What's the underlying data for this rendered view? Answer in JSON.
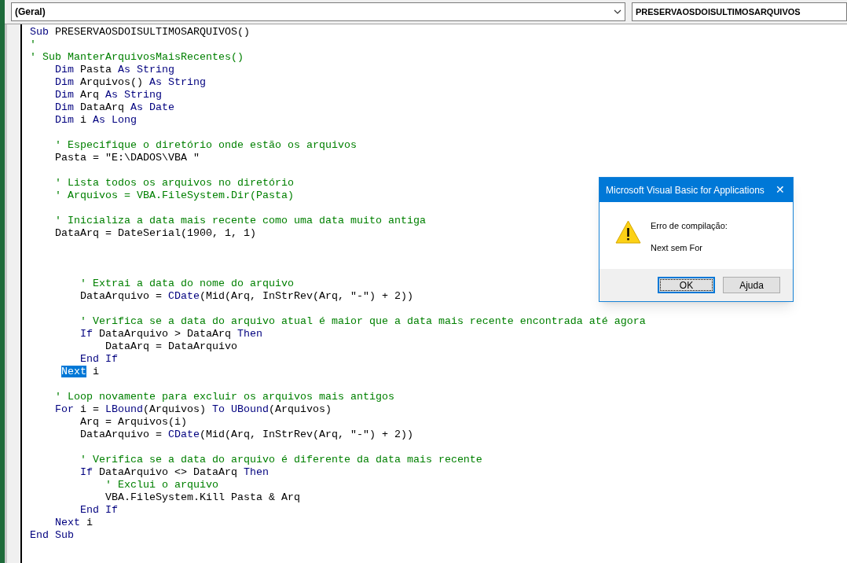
{
  "object_combo": {
    "value": "(Geral)"
  },
  "procedure_combo": {
    "value": "PRESERVAOSDOISULTIMOSARQUIVOS"
  },
  "code_lines": [
    {
      "kind": "code",
      "segments": [
        {
          "text": "Sub",
          "kind": "keyword"
        },
        {
          "text": " PRESERVAOSDOISULTIMOSARQUIVOS()",
          "kind": "plain"
        }
      ]
    },
    {
      "kind": "code",
      "segments": [
        {
          "text": "'",
          "kind": "comment"
        }
      ]
    },
    {
      "kind": "code",
      "segments": [
        {
          "text": "' Sub ManterArquivosMaisRecentes()",
          "kind": "comment"
        }
      ]
    },
    {
      "kind": "code",
      "segments": [
        {
          "text": "    Dim",
          "kind": "keyword"
        },
        {
          "text": " Pasta ",
          "kind": "plain"
        },
        {
          "text": "As String",
          "kind": "keyword"
        }
      ]
    },
    {
      "kind": "code",
      "segments": [
        {
          "text": "    Dim",
          "kind": "keyword"
        },
        {
          "text": " Arquivos() ",
          "kind": "plain"
        },
        {
          "text": "As String",
          "kind": "keyword"
        }
      ]
    },
    {
      "kind": "code",
      "segments": [
        {
          "text": "    Dim",
          "kind": "keyword"
        },
        {
          "text": " Arq ",
          "kind": "plain"
        },
        {
          "text": "As String",
          "kind": "keyword"
        }
      ]
    },
    {
      "kind": "code",
      "segments": [
        {
          "text": "    Dim",
          "kind": "keyword"
        },
        {
          "text": " DataArq ",
          "kind": "plain"
        },
        {
          "text": "As Date",
          "kind": "keyword"
        }
      ]
    },
    {
      "kind": "code",
      "segments": [
        {
          "text": "    Dim",
          "kind": "keyword"
        },
        {
          "text": " i ",
          "kind": "plain"
        },
        {
          "text": "As Long",
          "kind": "keyword"
        }
      ]
    },
    {
      "kind": "blank"
    },
    {
      "kind": "code",
      "segments": [
        {
          "text": "    ' Especifique o diretório onde estão os arquivos",
          "kind": "comment"
        }
      ]
    },
    {
      "kind": "code",
      "segments": [
        {
          "text": "    Pasta = \"E:\\DADOS\\VBA \"",
          "kind": "plain"
        }
      ]
    },
    {
      "kind": "blank"
    },
    {
      "kind": "code",
      "segments": [
        {
          "text": "    ' Lista todos os arquivos no diretório",
          "kind": "comment"
        }
      ]
    },
    {
      "kind": "code",
      "segments": [
        {
          "text": "    ' Arquivos = VBA.FileSystem.Dir(Pasta)",
          "kind": "comment"
        }
      ]
    },
    {
      "kind": "blank"
    },
    {
      "kind": "code",
      "segments": [
        {
          "text": "    ' Inicializa a data mais recente como uma data muito antiga",
          "kind": "comment"
        }
      ]
    },
    {
      "kind": "code",
      "segments": [
        {
          "text": "    DataArq = DateSerial(1900, 1, 1)",
          "kind": "plain"
        }
      ]
    },
    {
      "kind": "blank"
    },
    {
      "kind": "blank"
    },
    {
      "kind": "blank"
    },
    {
      "kind": "code",
      "segments": [
        {
          "text": "        ' Extrai a data do nome do arquivo",
          "kind": "comment"
        }
      ]
    },
    {
      "kind": "code",
      "segments": [
        {
          "text": "        DataArquivo = ",
          "kind": "plain"
        },
        {
          "text": "CDate",
          "kind": "keyword"
        },
        {
          "text": "(Mid(Arq, InStrRev(Arq, \"-\") + 2))",
          "kind": "plain"
        }
      ]
    },
    {
      "kind": "blank"
    },
    {
      "kind": "code",
      "segments": [
        {
          "text": "        ' Verifica se a data do arquivo atual é maior que a data mais recente encontrada até agora",
          "kind": "comment"
        }
      ]
    },
    {
      "kind": "code",
      "segments": [
        {
          "text": "        If",
          "kind": "keyword"
        },
        {
          "text": " DataArquivo > DataArq ",
          "kind": "plain"
        },
        {
          "text": "Then",
          "kind": "keyword"
        }
      ]
    },
    {
      "kind": "code",
      "segments": [
        {
          "text": "            DataArq = DataArquivo",
          "kind": "plain"
        }
      ]
    },
    {
      "kind": "code",
      "segments": [
        {
          "text": "        End If",
          "kind": "keyword"
        }
      ]
    },
    {
      "kind": "code_outdented",
      "segments": [
        {
          "text": "Next",
          "kind": "selected"
        },
        {
          "text": " i",
          "kind": "plain"
        }
      ]
    },
    {
      "kind": "blank"
    },
    {
      "kind": "code",
      "segments": [
        {
          "text": "    ' Loop novamente para excluir os arquivos mais antigos",
          "kind": "comment"
        }
      ]
    },
    {
      "kind": "code",
      "segments": [
        {
          "text": "    For",
          "kind": "keyword"
        },
        {
          "text": " i = ",
          "kind": "plain"
        },
        {
          "text": "LBound",
          "kind": "keyword"
        },
        {
          "text": "(Arquivos) ",
          "kind": "plain"
        },
        {
          "text": "To",
          "kind": "keyword"
        },
        {
          "text": " UBound",
          "kind": "keyword"
        },
        {
          "text": "(Arquivos)",
          "kind": "plain"
        }
      ]
    },
    {
      "kind": "code",
      "segments": [
        {
          "text": "        Arq = Arquivos(i)",
          "kind": "plain"
        }
      ]
    },
    {
      "kind": "code",
      "segments": [
        {
          "text": "        DataArquivo = ",
          "kind": "plain"
        },
        {
          "text": "CDate",
          "kind": "keyword"
        },
        {
          "text": "(Mid(Arq, InStrRev(Arq, \"-\") + 2))",
          "kind": "plain"
        }
      ]
    },
    {
      "kind": "blank"
    },
    {
      "kind": "code",
      "segments": [
        {
          "text": "        ' Verifica se a data do arquivo é diferente da data mais recente",
          "kind": "comment"
        }
      ]
    },
    {
      "kind": "code",
      "segments": [
        {
          "text": "        If",
          "kind": "keyword"
        },
        {
          "text": " DataArquivo <> DataArq ",
          "kind": "plain"
        },
        {
          "text": "Then",
          "kind": "keyword"
        }
      ]
    },
    {
      "kind": "code",
      "segments": [
        {
          "text": "            ' Exclui o arquivo",
          "kind": "comment"
        }
      ]
    },
    {
      "kind": "code",
      "segments": [
        {
          "text": "            VBA.FileSystem.Kill Pasta & Arq",
          "kind": "plain"
        }
      ]
    },
    {
      "kind": "code",
      "segments": [
        {
          "text": "        End If",
          "kind": "keyword"
        }
      ]
    },
    {
      "kind": "code",
      "segments": [
        {
          "text": "    Next",
          "kind": "keyword"
        },
        {
          "text": " i",
          "kind": "plain"
        }
      ]
    },
    {
      "kind": "code",
      "segments": [
        {
          "text": "End Sub",
          "kind": "keyword"
        }
      ]
    }
  ],
  "dialog": {
    "title": "Microsoft Visual Basic for Applications",
    "close": "✕",
    "heading": "Erro de compilação:",
    "message": "Next sem For",
    "buttons": [
      {
        "label": "OK",
        "selected": true
      },
      {
        "label": "Ajuda",
        "selected": false
      }
    ]
  }
}
